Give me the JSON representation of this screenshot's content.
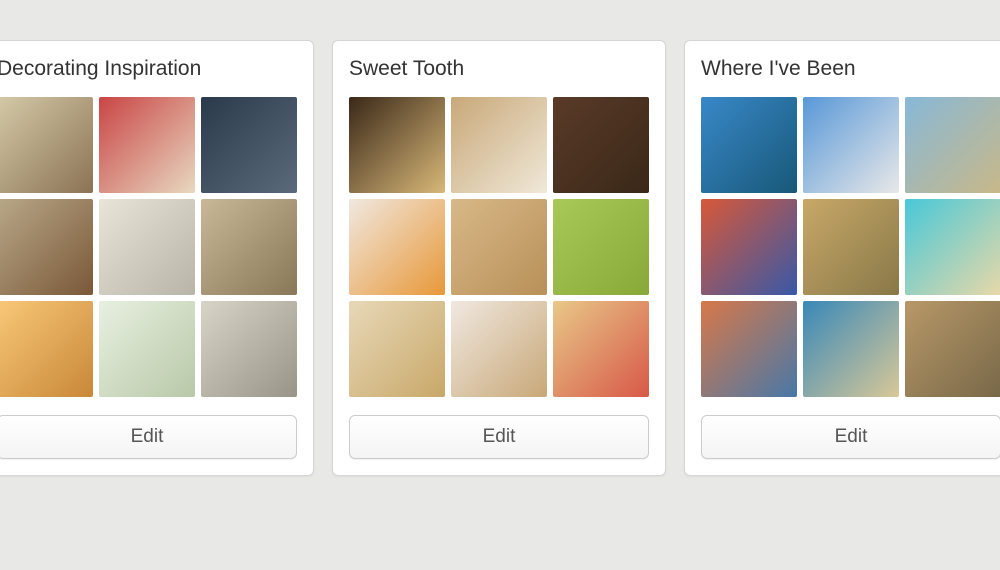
{
  "boards": [
    {
      "title": "Decorating Inspiration",
      "edit_label": "Edit",
      "thumbs": [
        "t-interior-1",
        "t-interior-2",
        "t-interior-3",
        "t-interior-4",
        "t-interior-5",
        "t-interior-6",
        "t-interior-7",
        "t-interior-8",
        "t-interior-9"
      ]
    },
    {
      "title": "Sweet Tooth",
      "edit_label": "Edit",
      "thumbs": [
        "t-food-1",
        "t-food-2",
        "t-food-3",
        "t-food-4",
        "t-food-5",
        "t-food-6",
        "t-food-7",
        "t-food-8",
        "t-food-9"
      ]
    },
    {
      "title": "Where I've Been",
      "edit_label": "Edit",
      "thumbs": [
        "t-travel-1",
        "t-travel-2",
        "t-travel-3",
        "t-travel-4",
        "t-travel-5",
        "t-travel-6",
        "t-travel-7",
        "t-travel-8",
        "t-travel-9"
      ]
    }
  ]
}
